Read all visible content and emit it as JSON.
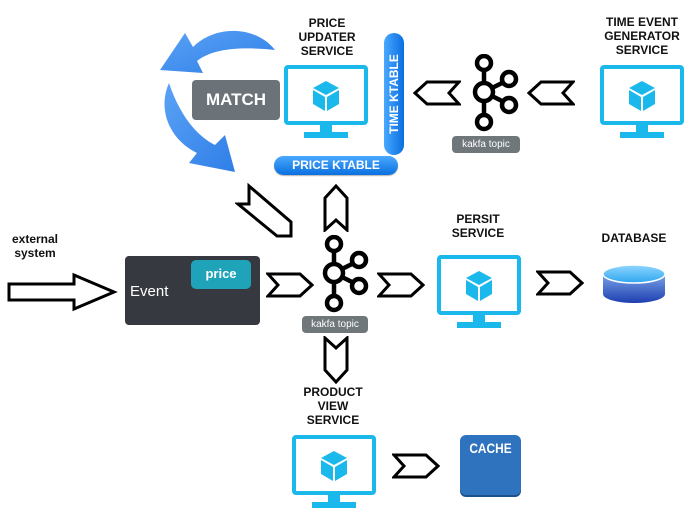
{
  "colors": {
    "monitor": "#1bb8ec",
    "cube": "#1bb8ec",
    "match_box": "#6b7379",
    "event_box": "#363a40",
    "price_pill": "#1ea3b8",
    "ktable": "#1a82f0",
    "cache": "#2f72bd",
    "kafka_tag": "#6f777b",
    "cycle_arrows": "#3d8ef0"
  },
  "labels": {
    "price_updater_service": "PRICE\nUPDATER\nSERVICE",
    "time_event_generator_service": "TIME EVENT\nGENERATOR\nSERVICE",
    "persist_service": "PERSIT\nSERVICE",
    "database": "DATABASE",
    "product_view_service": "PRODUCT\nVIEW\nSERVICE",
    "external_system": "external\nsystem"
  },
  "boxes": {
    "match": "MATCH",
    "event": "Event",
    "price": "price",
    "cache": "CACHE",
    "price_ktable": "PRICE KTABLE",
    "time_ktable": "TIME KTABLE"
  },
  "kafka_topics": {
    "top": "kakfa topic",
    "center": "kakfa topic"
  },
  "icons": {
    "service": "monitor-with-cube-icon",
    "kafka": "kafka-topic-icon",
    "database": "database-cylinder-icon",
    "cycle": "circular-arrows-icon",
    "flow": "chevron-arrow-icon"
  }
}
